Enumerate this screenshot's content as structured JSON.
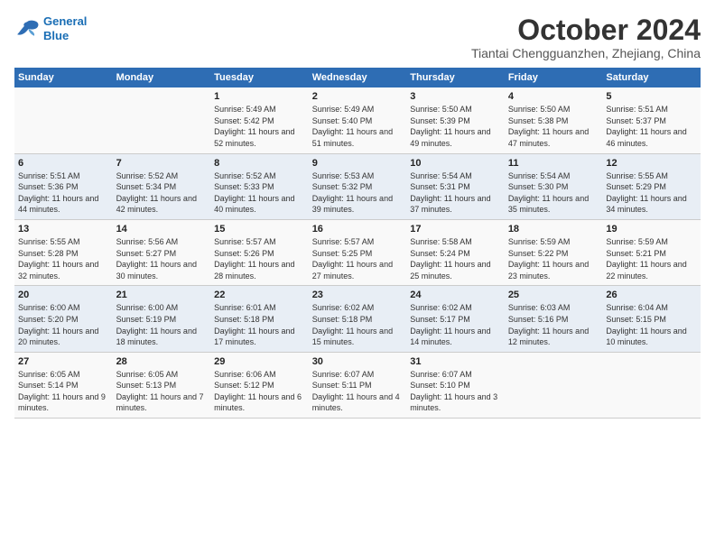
{
  "logo": {
    "line1": "General",
    "line2": "Blue"
  },
  "title": "October 2024",
  "location": "Tiantai Chengguanzhen, Zhejiang, China",
  "days_header": [
    "Sunday",
    "Monday",
    "Tuesday",
    "Wednesday",
    "Thursday",
    "Friday",
    "Saturday"
  ],
  "weeks": [
    [
      {
        "day": "",
        "info": ""
      },
      {
        "day": "",
        "info": ""
      },
      {
        "day": "1",
        "info": "Sunrise: 5:49 AM\nSunset: 5:42 PM\nDaylight: 11 hours and 52 minutes."
      },
      {
        "day": "2",
        "info": "Sunrise: 5:49 AM\nSunset: 5:40 PM\nDaylight: 11 hours and 51 minutes."
      },
      {
        "day": "3",
        "info": "Sunrise: 5:50 AM\nSunset: 5:39 PM\nDaylight: 11 hours and 49 minutes."
      },
      {
        "day": "4",
        "info": "Sunrise: 5:50 AM\nSunset: 5:38 PM\nDaylight: 11 hours and 47 minutes."
      },
      {
        "day": "5",
        "info": "Sunrise: 5:51 AM\nSunset: 5:37 PM\nDaylight: 11 hours and 46 minutes."
      }
    ],
    [
      {
        "day": "6",
        "info": "Sunrise: 5:51 AM\nSunset: 5:36 PM\nDaylight: 11 hours and 44 minutes."
      },
      {
        "day": "7",
        "info": "Sunrise: 5:52 AM\nSunset: 5:34 PM\nDaylight: 11 hours and 42 minutes."
      },
      {
        "day": "8",
        "info": "Sunrise: 5:52 AM\nSunset: 5:33 PM\nDaylight: 11 hours and 40 minutes."
      },
      {
        "day": "9",
        "info": "Sunrise: 5:53 AM\nSunset: 5:32 PM\nDaylight: 11 hours and 39 minutes."
      },
      {
        "day": "10",
        "info": "Sunrise: 5:54 AM\nSunset: 5:31 PM\nDaylight: 11 hours and 37 minutes."
      },
      {
        "day": "11",
        "info": "Sunrise: 5:54 AM\nSunset: 5:30 PM\nDaylight: 11 hours and 35 minutes."
      },
      {
        "day": "12",
        "info": "Sunrise: 5:55 AM\nSunset: 5:29 PM\nDaylight: 11 hours and 34 minutes."
      }
    ],
    [
      {
        "day": "13",
        "info": "Sunrise: 5:55 AM\nSunset: 5:28 PM\nDaylight: 11 hours and 32 minutes."
      },
      {
        "day": "14",
        "info": "Sunrise: 5:56 AM\nSunset: 5:27 PM\nDaylight: 11 hours and 30 minutes."
      },
      {
        "day": "15",
        "info": "Sunrise: 5:57 AM\nSunset: 5:26 PM\nDaylight: 11 hours and 28 minutes."
      },
      {
        "day": "16",
        "info": "Sunrise: 5:57 AM\nSunset: 5:25 PM\nDaylight: 11 hours and 27 minutes."
      },
      {
        "day": "17",
        "info": "Sunrise: 5:58 AM\nSunset: 5:24 PM\nDaylight: 11 hours and 25 minutes."
      },
      {
        "day": "18",
        "info": "Sunrise: 5:59 AM\nSunset: 5:22 PM\nDaylight: 11 hours and 23 minutes."
      },
      {
        "day": "19",
        "info": "Sunrise: 5:59 AM\nSunset: 5:21 PM\nDaylight: 11 hours and 22 minutes."
      }
    ],
    [
      {
        "day": "20",
        "info": "Sunrise: 6:00 AM\nSunset: 5:20 PM\nDaylight: 11 hours and 20 minutes."
      },
      {
        "day": "21",
        "info": "Sunrise: 6:00 AM\nSunset: 5:19 PM\nDaylight: 11 hours and 18 minutes."
      },
      {
        "day": "22",
        "info": "Sunrise: 6:01 AM\nSunset: 5:18 PM\nDaylight: 11 hours and 17 minutes."
      },
      {
        "day": "23",
        "info": "Sunrise: 6:02 AM\nSunset: 5:18 PM\nDaylight: 11 hours and 15 minutes."
      },
      {
        "day": "24",
        "info": "Sunrise: 6:02 AM\nSunset: 5:17 PM\nDaylight: 11 hours and 14 minutes."
      },
      {
        "day": "25",
        "info": "Sunrise: 6:03 AM\nSunset: 5:16 PM\nDaylight: 11 hours and 12 minutes."
      },
      {
        "day": "26",
        "info": "Sunrise: 6:04 AM\nSunset: 5:15 PM\nDaylight: 11 hours and 10 minutes."
      }
    ],
    [
      {
        "day": "27",
        "info": "Sunrise: 6:05 AM\nSunset: 5:14 PM\nDaylight: 11 hours and 9 minutes."
      },
      {
        "day": "28",
        "info": "Sunrise: 6:05 AM\nSunset: 5:13 PM\nDaylight: 11 hours and 7 minutes."
      },
      {
        "day": "29",
        "info": "Sunrise: 6:06 AM\nSunset: 5:12 PM\nDaylight: 11 hours and 6 minutes."
      },
      {
        "day": "30",
        "info": "Sunrise: 6:07 AM\nSunset: 5:11 PM\nDaylight: 11 hours and 4 minutes."
      },
      {
        "day": "31",
        "info": "Sunrise: 6:07 AM\nSunset: 5:10 PM\nDaylight: 11 hours and 3 minutes."
      },
      {
        "day": "",
        "info": ""
      },
      {
        "day": "",
        "info": ""
      }
    ]
  ]
}
